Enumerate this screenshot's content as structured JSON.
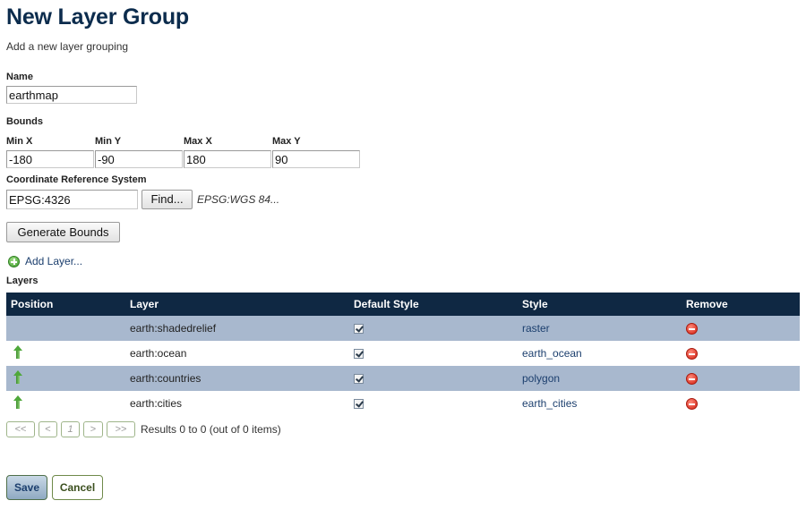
{
  "page": {
    "title": "New Layer Group",
    "subtitle": "Add a new layer grouping"
  },
  "name": {
    "label": "Name",
    "value": "earthmap"
  },
  "bounds": {
    "label": "Bounds",
    "minx_label": "Min X",
    "miny_label": "Min Y",
    "maxx_label": "Max X",
    "maxy_label": "Max Y",
    "minx": "-180",
    "miny": "-90",
    "maxx": "180",
    "maxy": "90"
  },
  "crs": {
    "label": "Coordinate Reference System",
    "value": "EPSG:4326",
    "find_label": "Find...",
    "description": "EPSG:WGS 84..."
  },
  "generate_bounds_label": "Generate Bounds",
  "add_layer_label": "Add Layer...",
  "layers": {
    "label": "Layers",
    "columns": [
      "Position",
      "Layer",
      "Default Style",
      "Style",
      "Remove"
    ],
    "rows": [
      {
        "layer": "earth:shadedrelief",
        "style": "raster",
        "default_style": true,
        "can_move_up": false
      },
      {
        "layer": "earth:ocean",
        "style": "earth_ocean",
        "default_style": true,
        "can_move_up": true
      },
      {
        "layer": "earth:countries",
        "style": "polygon",
        "default_style": true,
        "can_move_up": true
      },
      {
        "layer": "earth:cities",
        "style": "earth_cities",
        "default_style": true,
        "can_move_up": true
      }
    ]
  },
  "pager": {
    "first": "<<",
    "prev": "<",
    "page": "1",
    "next": ">",
    "last": ">>",
    "info": "Results 0 to 0 (out of 0 items)"
  },
  "actions": {
    "save": "Save",
    "cancel": "Cancel"
  },
  "colors": {
    "heading": "#0c2c4d",
    "table_header": "#0f2843",
    "row_alt": "#a8b8ce",
    "link": "#1c3f6e"
  },
  "icons": {
    "add": "add-circle-icon",
    "move_up": "arrow-up-icon",
    "remove": "remove-circle-icon",
    "checkbox": "checkbox-checked-icon"
  }
}
